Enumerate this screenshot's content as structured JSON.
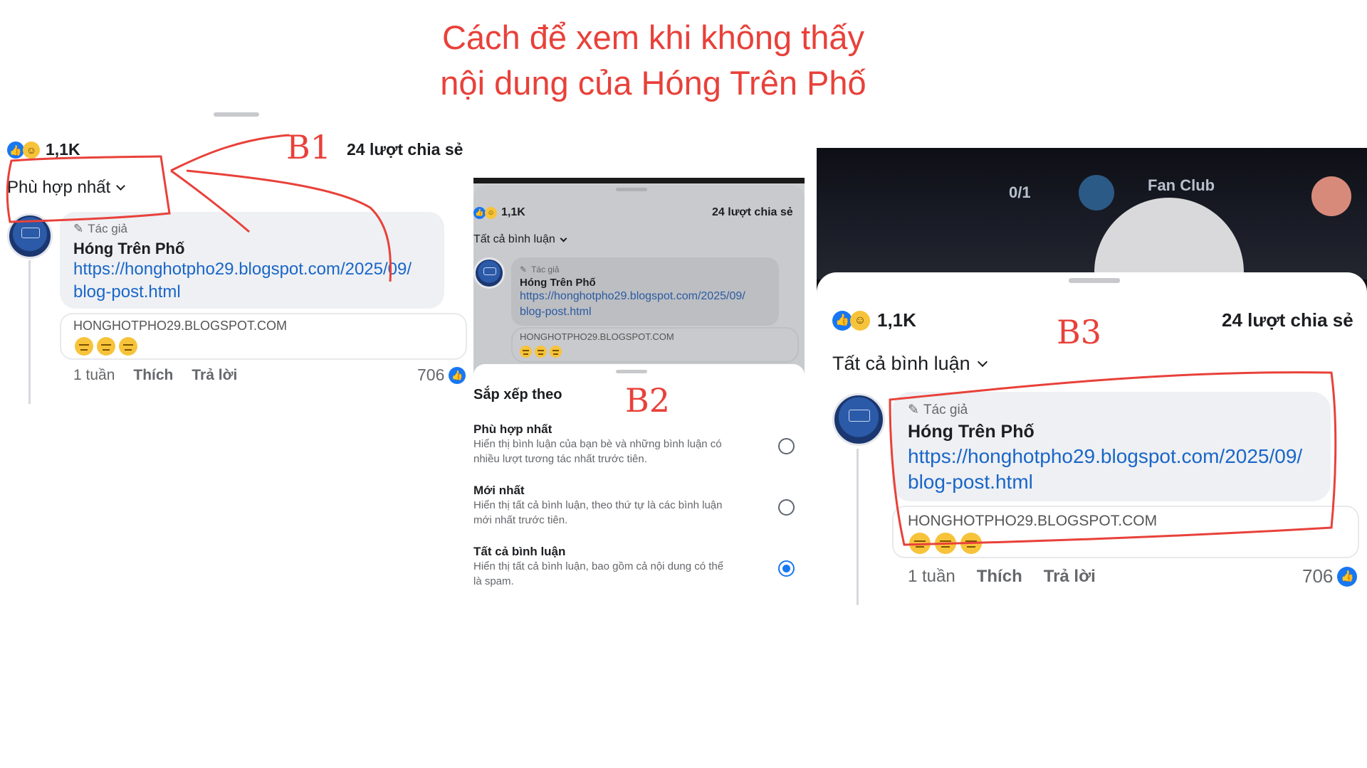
{
  "page": {
    "title_line1": "Cách để xem khi không thấy",
    "title_line2": "nội dung của Hóng Trên Phố"
  },
  "steps": {
    "b1": "B1",
    "b2": "B2",
    "b3": "B3"
  },
  "post": {
    "reaction_count": "1,1K",
    "shares": "24 lượt chia sẻ",
    "author_badge": "Tác giả",
    "author_name": "Hóng Trên Phố",
    "link_line1": "https://honghotpho29.blogspot.com/2025/09/",
    "link_line2": "blog-post.html",
    "preview_domain": "HONGHOTPHO29.BLOGSPOT.COM",
    "time_ago": "1 tuần",
    "like_action": "Thích",
    "reply_action": "Trả lời",
    "like_count": "706"
  },
  "screens": {
    "step1": {
      "sort_label": "Phù hợp nhất"
    },
    "step2": {
      "sort_label": "Tất cả bình luận",
      "sheet_title": "Sắp xếp theo",
      "options": [
        {
          "label": "Phù hợp nhất",
          "desc_line1": "Hiển thị bình luận của bạn bè và những bình luận có",
          "desc_line2": "nhiều lượt tương tác nhất trước tiên.",
          "selected": false
        },
        {
          "label": "Mới nhất",
          "desc_line1": "Hiển thị tất cả bình luận, theo thứ tự là các bình luận",
          "desc_line2": "mới nhất trước tiên.",
          "selected": false
        },
        {
          "label": "Tất cả bình luận",
          "desc_line1": "Hiển thị tất cả bình luận, bao gồm cả nội dung có thể",
          "desc_line2": "là spam.",
          "selected": true
        }
      ]
    },
    "step3": {
      "sort_label": "Tất cả bình luận",
      "bg_counter": "0/1",
      "bg_label": "Fan Club"
    }
  },
  "colors": {
    "annotation": "#e8413a",
    "link": "#1a66c8",
    "accent": "#1877f2"
  }
}
